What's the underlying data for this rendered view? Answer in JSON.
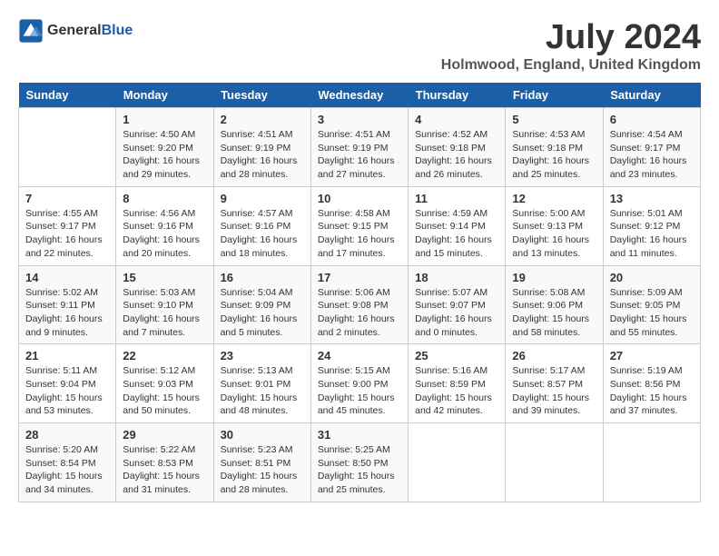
{
  "logo": {
    "line1": "General",
    "line2": "Blue"
  },
  "title": "July 2024",
  "subtitle": "Holmwood, England, United Kingdom",
  "header_color": "#1a5fa8",
  "days_of_week": [
    "Sunday",
    "Monday",
    "Tuesday",
    "Wednesday",
    "Thursday",
    "Friday",
    "Saturday"
  ],
  "weeks": [
    [
      {
        "day": "",
        "info": ""
      },
      {
        "day": "1",
        "info": "Sunrise: 4:50 AM\nSunset: 9:20 PM\nDaylight: 16 hours\nand 29 minutes."
      },
      {
        "day": "2",
        "info": "Sunrise: 4:51 AM\nSunset: 9:19 PM\nDaylight: 16 hours\nand 28 minutes."
      },
      {
        "day": "3",
        "info": "Sunrise: 4:51 AM\nSunset: 9:19 PM\nDaylight: 16 hours\nand 27 minutes."
      },
      {
        "day": "4",
        "info": "Sunrise: 4:52 AM\nSunset: 9:18 PM\nDaylight: 16 hours\nand 26 minutes."
      },
      {
        "day": "5",
        "info": "Sunrise: 4:53 AM\nSunset: 9:18 PM\nDaylight: 16 hours\nand 25 minutes."
      },
      {
        "day": "6",
        "info": "Sunrise: 4:54 AM\nSunset: 9:17 PM\nDaylight: 16 hours\nand 23 minutes."
      }
    ],
    [
      {
        "day": "7",
        "info": "Sunrise: 4:55 AM\nSunset: 9:17 PM\nDaylight: 16 hours\nand 22 minutes."
      },
      {
        "day": "8",
        "info": "Sunrise: 4:56 AM\nSunset: 9:16 PM\nDaylight: 16 hours\nand 20 minutes."
      },
      {
        "day": "9",
        "info": "Sunrise: 4:57 AM\nSunset: 9:16 PM\nDaylight: 16 hours\nand 18 minutes."
      },
      {
        "day": "10",
        "info": "Sunrise: 4:58 AM\nSunset: 9:15 PM\nDaylight: 16 hours\nand 17 minutes."
      },
      {
        "day": "11",
        "info": "Sunrise: 4:59 AM\nSunset: 9:14 PM\nDaylight: 16 hours\nand 15 minutes."
      },
      {
        "day": "12",
        "info": "Sunrise: 5:00 AM\nSunset: 9:13 PM\nDaylight: 16 hours\nand 13 minutes."
      },
      {
        "day": "13",
        "info": "Sunrise: 5:01 AM\nSunset: 9:12 PM\nDaylight: 16 hours\nand 11 minutes."
      }
    ],
    [
      {
        "day": "14",
        "info": "Sunrise: 5:02 AM\nSunset: 9:11 PM\nDaylight: 16 hours\nand 9 minutes."
      },
      {
        "day": "15",
        "info": "Sunrise: 5:03 AM\nSunset: 9:10 PM\nDaylight: 16 hours\nand 7 minutes."
      },
      {
        "day": "16",
        "info": "Sunrise: 5:04 AM\nSunset: 9:09 PM\nDaylight: 16 hours\nand 5 minutes."
      },
      {
        "day": "17",
        "info": "Sunrise: 5:06 AM\nSunset: 9:08 PM\nDaylight: 16 hours\nand 2 minutes."
      },
      {
        "day": "18",
        "info": "Sunrise: 5:07 AM\nSunset: 9:07 PM\nDaylight: 16 hours\nand 0 minutes."
      },
      {
        "day": "19",
        "info": "Sunrise: 5:08 AM\nSunset: 9:06 PM\nDaylight: 15 hours\nand 58 minutes."
      },
      {
        "day": "20",
        "info": "Sunrise: 5:09 AM\nSunset: 9:05 PM\nDaylight: 15 hours\nand 55 minutes."
      }
    ],
    [
      {
        "day": "21",
        "info": "Sunrise: 5:11 AM\nSunset: 9:04 PM\nDaylight: 15 hours\nand 53 minutes."
      },
      {
        "day": "22",
        "info": "Sunrise: 5:12 AM\nSunset: 9:03 PM\nDaylight: 15 hours\nand 50 minutes."
      },
      {
        "day": "23",
        "info": "Sunrise: 5:13 AM\nSunset: 9:01 PM\nDaylight: 15 hours\nand 48 minutes."
      },
      {
        "day": "24",
        "info": "Sunrise: 5:15 AM\nSunset: 9:00 PM\nDaylight: 15 hours\nand 45 minutes."
      },
      {
        "day": "25",
        "info": "Sunrise: 5:16 AM\nSunset: 8:59 PM\nDaylight: 15 hours\nand 42 minutes."
      },
      {
        "day": "26",
        "info": "Sunrise: 5:17 AM\nSunset: 8:57 PM\nDaylight: 15 hours\nand 39 minutes."
      },
      {
        "day": "27",
        "info": "Sunrise: 5:19 AM\nSunset: 8:56 PM\nDaylight: 15 hours\nand 37 minutes."
      }
    ],
    [
      {
        "day": "28",
        "info": "Sunrise: 5:20 AM\nSunset: 8:54 PM\nDaylight: 15 hours\nand 34 minutes."
      },
      {
        "day": "29",
        "info": "Sunrise: 5:22 AM\nSunset: 8:53 PM\nDaylight: 15 hours\nand 31 minutes."
      },
      {
        "day": "30",
        "info": "Sunrise: 5:23 AM\nSunset: 8:51 PM\nDaylight: 15 hours\nand 28 minutes."
      },
      {
        "day": "31",
        "info": "Sunrise: 5:25 AM\nSunset: 8:50 PM\nDaylight: 15 hours\nand 25 minutes."
      },
      {
        "day": "",
        "info": ""
      },
      {
        "day": "",
        "info": ""
      },
      {
        "day": "",
        "info": ""
      }
    ]
  ]
}
